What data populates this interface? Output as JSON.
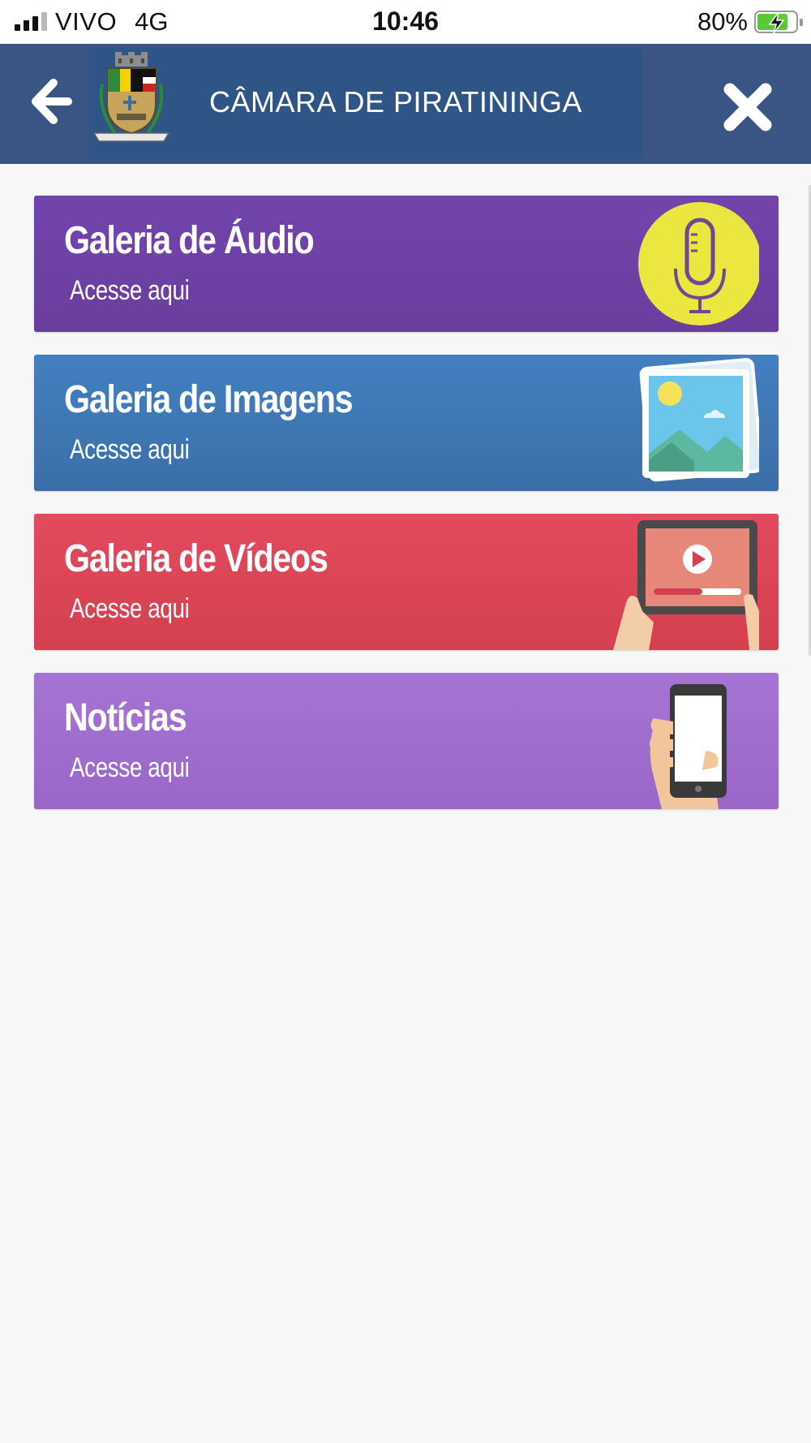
{
  "status_bar": {
    "carrier": "VIVO",
    "network": "4G",
    "time": "10:46",
    "battery": "80%",
    "battery_level": 0.8
  },
  "header": {
    "title": "CÂMARA DE PIRATININGA",
    "back_icon": "arrow-left-icon",
    "close_icon": "close-x-icon",
    "crest_icon": "municipal-crest-icon"
  },
  "cards": [
    {
      "title": "Galeria de Áudio",
      "subtitle": "Acesse aqui",
      "icon": "microphone-icon",
      "color": "#6e41a6"
    },
    {
      "title": "Galeria de Imagens",
      "subtitle": "Acesse aqui",
      "icon": "picture-gallery-icon",
      "color": "#4079b8"
    },
    {
      "title": "Galeria de Vídeos",
      "subtitle": "Acesse aqui",
      "icon": "tablet-video-icon",
      "color": "#dc4757"
    },
    {
      "title": "Notícias",
      "subtitle": "Acesse aqui",
      "icon": "phone-in-hand-icon",
      "color": "#a06ed0"
    }
  ]
}
